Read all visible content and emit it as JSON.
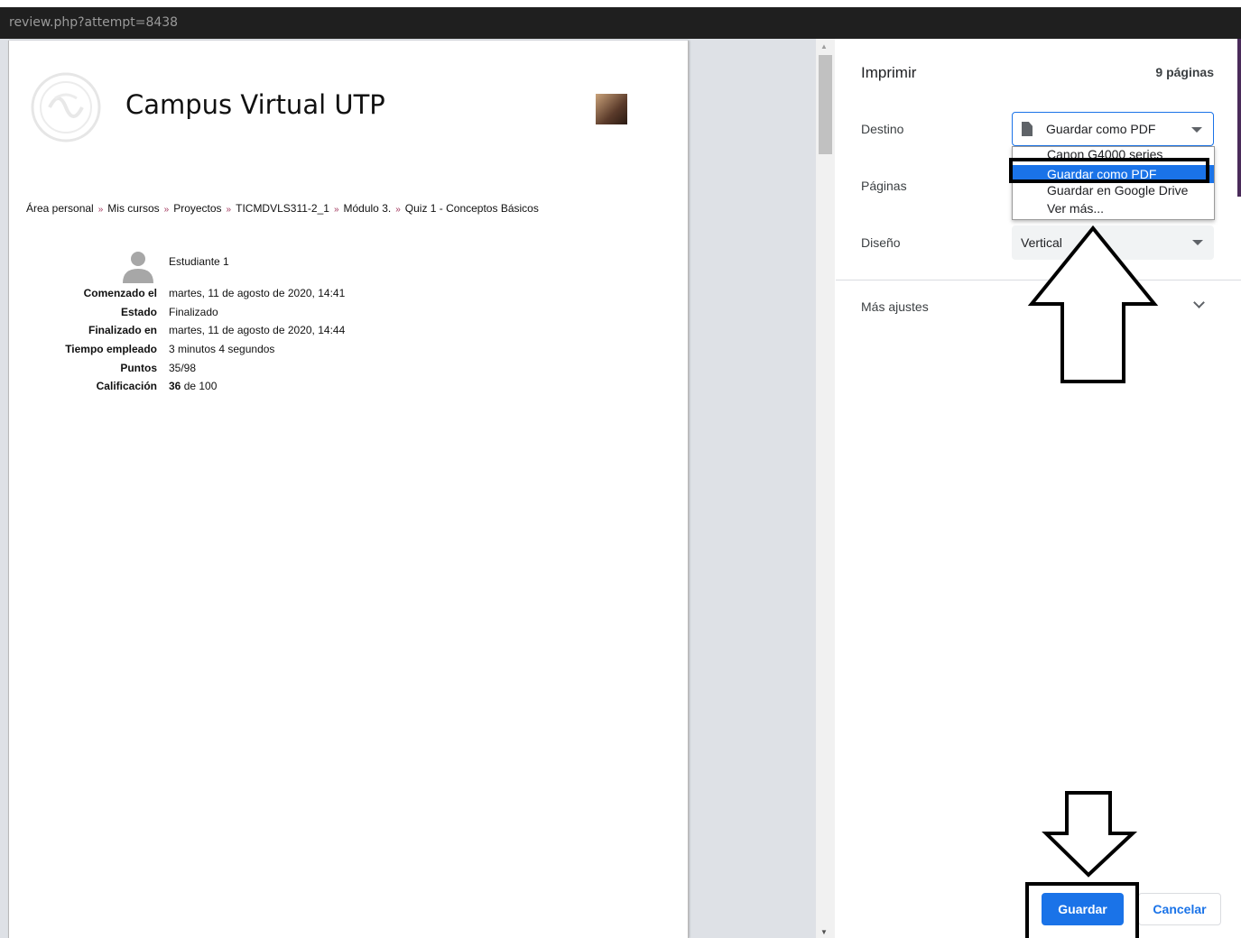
{
  "window": {
    "url": "review.php?attempt=8438"
  },
  "page": {
    "site_title": "Campus Virtual UTP",
    "breadcrumb": [
      "Área personal",
      "Mis cursos",
      "Proyectos",
      "TICMDVLS311-2_1",
      "Módulo 3.",
      "Quiz 1 - Conceptos Básicos"
    ],
    "breadcrumb_sep": "»",
    "user_name": "Estudiante 1",
    "summary": [
      {
        "label": "Comenzado el",
        "value": "martes, 11 de agosto de 2020, 14:41"
      },
      {
        "label": "Estado",
        "value": "Finalizado"
      },
      {
        "label": "Finalizado en",
        "value": "martes, 11 de agosto de 2020, 14:44"
      },
      {
        "label": "Tiempo empleado",
        "value": "3 minutos 4 segundos"
      },
      {
        "label": "Puntos",
        "value": "35/98"
      },
      {
        "label": "Calificación",
        "value_bold": "36",
        "value_rest": " de 100"
      }
    ]
  },
  "print_panel": {
    "title": "Imprimir",
    "page_count": "9 páginas",
    "destino_label": "Destino",
    "destino_value": "Guardar como PDF",
    "destino_options": [
      "Canon G4000 series",
      "Guardar como PDF",
      "Guardar en Google Drive",
      "Ver más..."
    ],
    "paginas_label": "Páginas",
    "diseno_label": "Diseño",
    "diseno_value": "Vertical",
    "more_settings": "Más ajustes",
    "save_button": "Guardar",
    "cancel_button": "Cancelar"
  },
  "colors": {
    "accent": "#1a73e8",
    "breadcrumb_sep": "#a0355b",
    "titlebar": "#1f1f1f"
  }
}
